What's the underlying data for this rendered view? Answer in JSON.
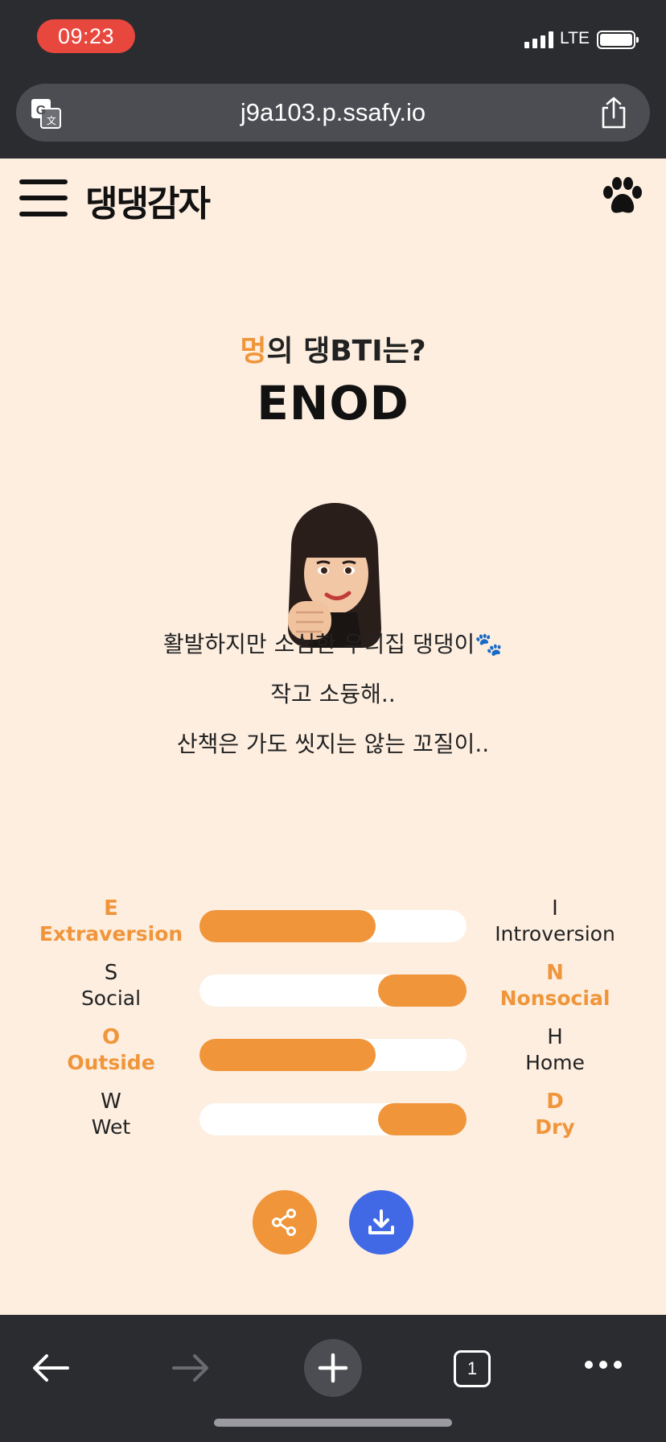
{
  "status_bar": {
    "time": "09:23",
    "network": "LTE",
    "colors": {
      "time_pill": "#e8473e"
    }
  },
  "browser": {
    "url": "j9a103.p.ssafy.io"
  },
  "header": {
    "brand": "댕댕감자",
    "icons": [
      "menu-icon",
      "paw-icon"
    ]
  },
  "result": {
    "question_highlight": "멍",
    "question_rest": "의 댕BTI는?",
    "type": "ENOD",
    "description": [
      "활발하지만 소심한 우리집 댕댕이🐾",
      "작고 소듕해..",
      "산책은 가도 씻지는 않는 꼬질이.."
    ]
  },
  "traits": [
    {
      "left_letter": "E",
      "left_word": "Extraversion",
      "right_letter": "I",
      "right_word": "Introversion",
      "active": "left",
      "score_left": 0.66
    },
    {
      "left_letter": "S",
      "left_word": "Social",
      "right_letter": "N",
      "right_word": "Nonsocial",
      "active": "right",
      "score_right": 0.33
    },
    {
      "left_letter": "O",
      "left_word": "Outside",
      "right_letter": "H",
      "right_word": "Home",
      "active": "left",
      "score_left": 0.66
    },
    {
      "left_letter": "W",
      "left_word": "Wet",
      "right_letter": "D",
      "right_word": "Dry",
      "active": "right",
      "score_right": 0.33
    }
  ],
  "actions": {
    "icons": [
      "share-icon",
      "download-icon"
    ]
  },
  "toolbar": {
    "tab_count": "1",
    "icons": [
      "back-arrow-icon",
      "forward-arrow-icon",
      "plus-icon",
      "tabs-icon",
      "more-icon"
    ]
  },
  "colors": {
    "accent": "#f0953a",
    "page_bg": "#fdeee0",
    "download": "#4169e6",
    "chrome": "#2b2c30"
  }
}
